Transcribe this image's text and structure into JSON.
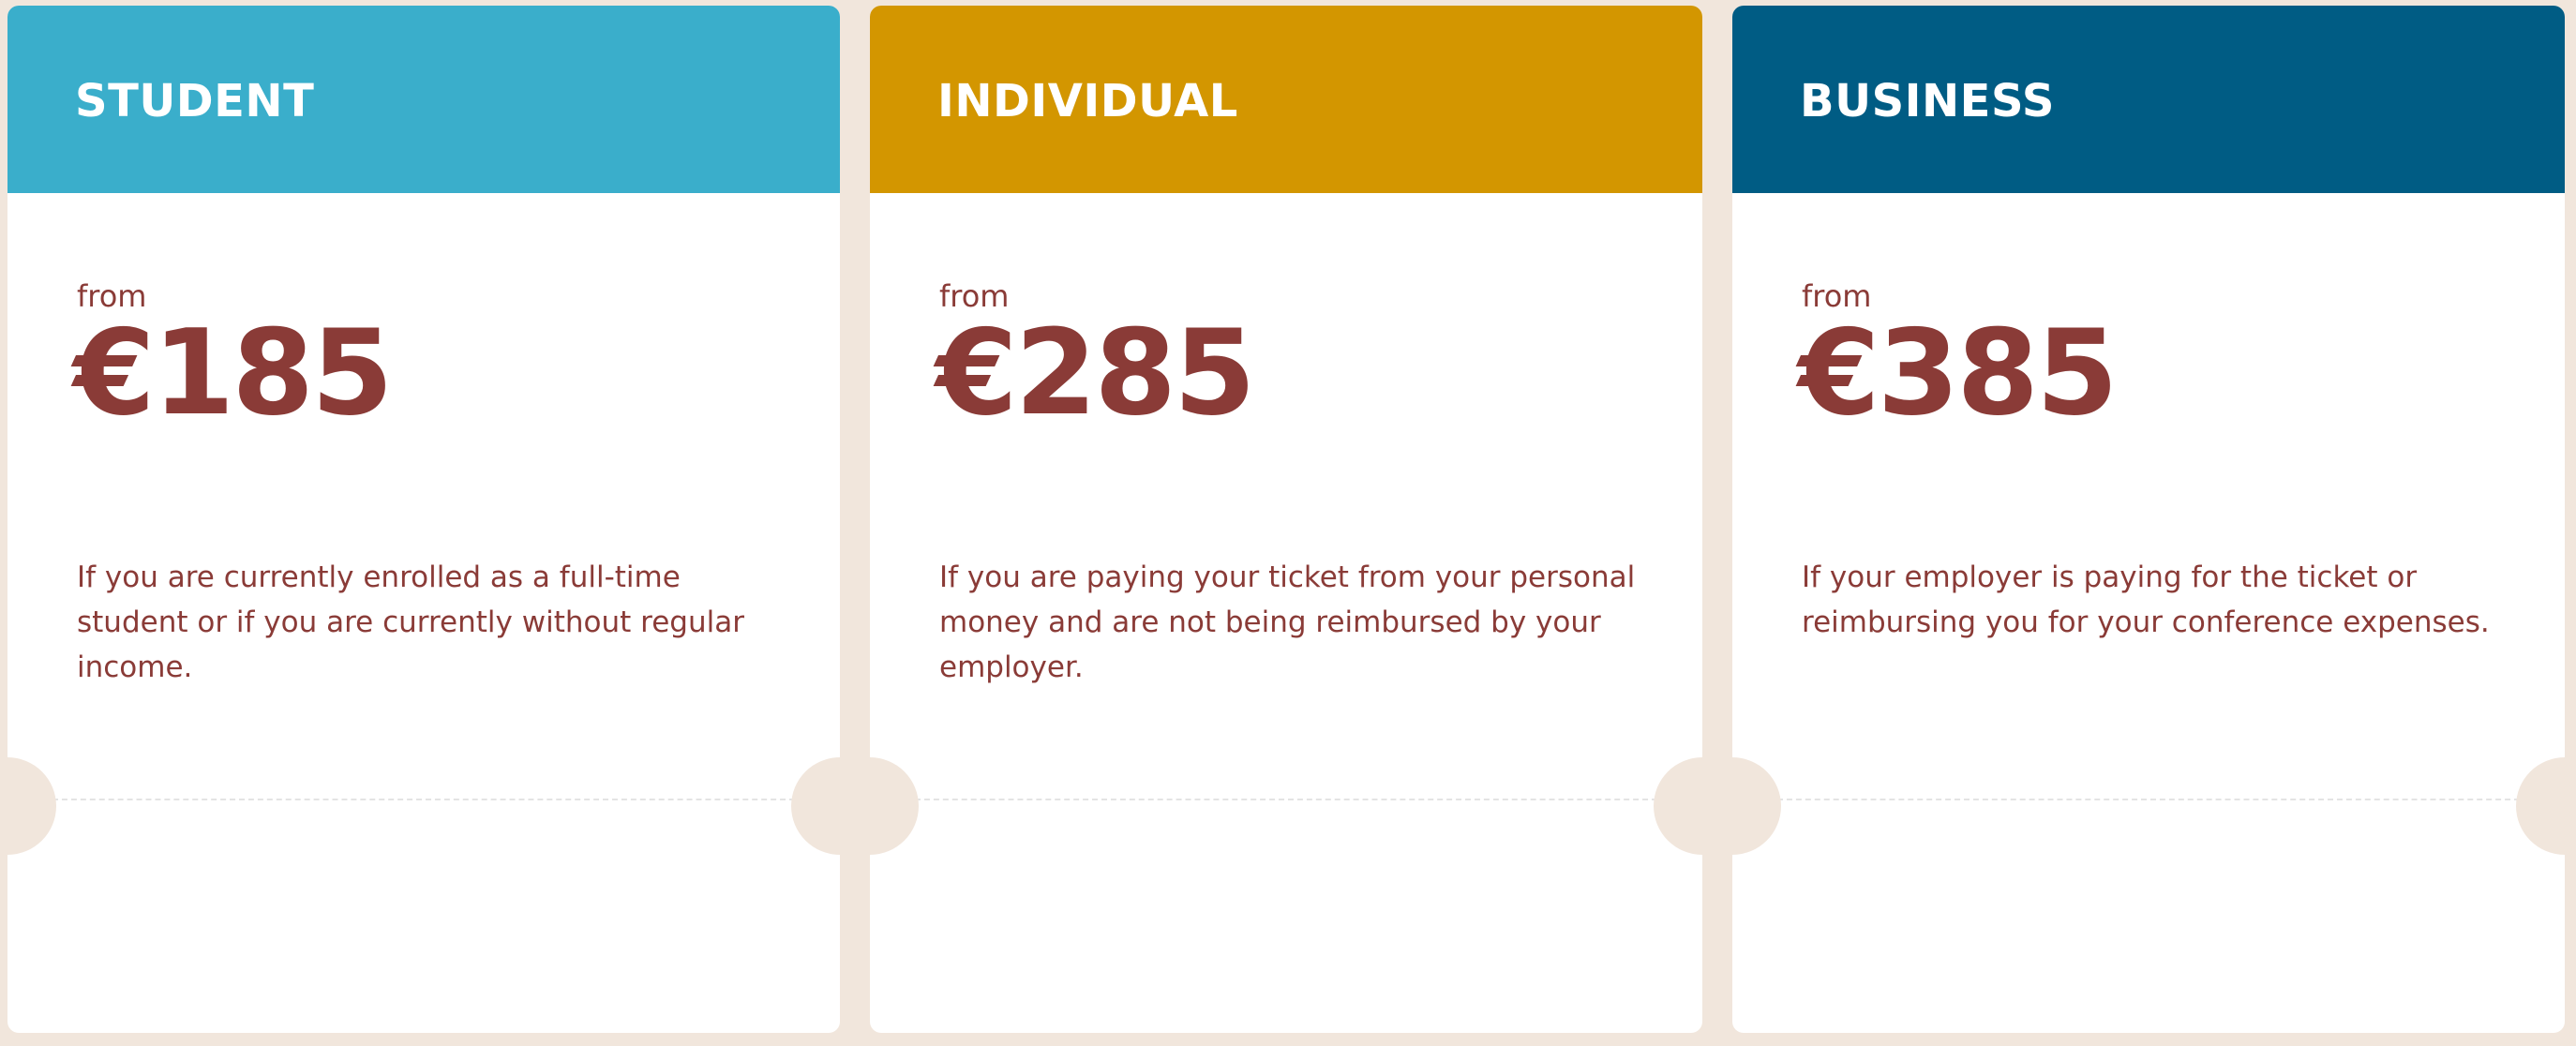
{
  "colors": {
    "page_background": "#f1e6dc",
    "card_background": "#ffffff",
    "text_primary": "#8a3b37",
    "header_text": "#ffffff",
    "divider": "#e4e4e4"
  },
  "tiers": [
    {
      "title": "STUDENT",
      "header_color": "#3aaecb",
      "from_label": "from",
      "price": "€185",
      "description": "If you are currently enrolled as a full-time student or if you are currently without regular income."
    },
    {
      "title": "INDIVIDUAL",
      "header_color": "#d39600",
      "from_label": "from",
      "price": "€285",
      "description": "If you are paying your ticket from your personal money and are not being reimbursed by your employer."
    },
    {
      "title": "BUSINESS",
      "header_color": "#005c84",
      "from_label": "from",
      "price": "€385",
      "description": "If your employer is paying for the ticket or reimbursing you for your conference expenses."
    }
  ]
}
